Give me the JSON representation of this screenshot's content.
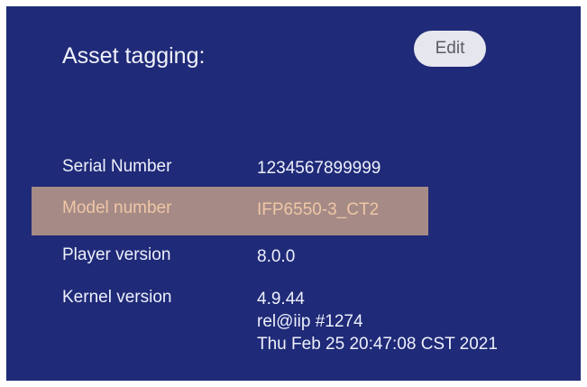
{
  "asset": {
    "title": "Asset tagging:",
    "edit_label": "Edit"
  },
  "info": {
    "serial": {
      "label": "Serial Number",
      "value": "1234567899999"
    },
    "model": {
      "label": "Model number",
      "value": "IFP6550-3_CT2"
    },
    "player": {
      "label": "Player version",
      "value": "8.0.0"
    },
    "kernel": {
      "label": "Kernel version",
      "lines": [
        "4.9.44",
        "rel@iip #1274",
        "Thu Feb 25 20:47:08 CST 2021"
      ]
    }
  },
  "colors": {
    "panel_bg": "#1f2a78",
    "highlight_bg": "#a58a86",
    "highlight_text": "#f0c7a6",
    "button_bg": "#e6e6ee"
  }
}
